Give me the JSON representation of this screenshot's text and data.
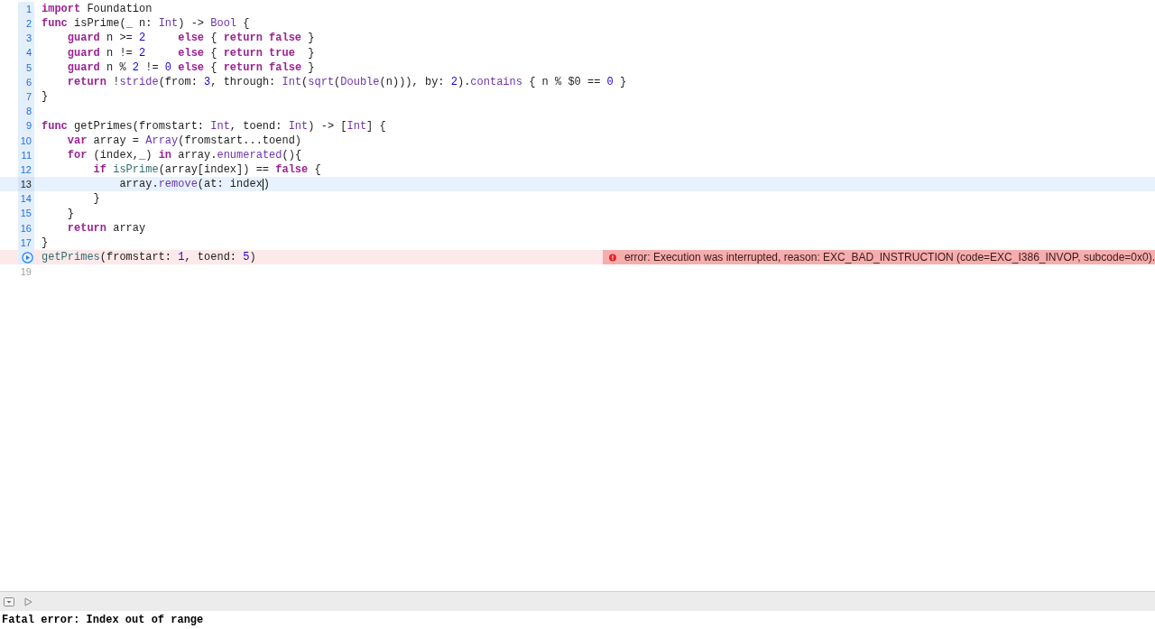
{
  "editor": {
    "lines": [
      {
        "number": "1",
        "executed": true,
        "current": false,
        "tokens": [
          {
            "kind": "kw",
            "text": "import"
          },
          {
            "kind": "plain",
            "text": " Foundation"
          }
        ]
      },
      {
        "number": "2",
        "executed": true,
        "current": false,
        "tokens": [
          {
            "kind": "kw",
            "text": "func"
          },
          {
            "kind": "plain",
            "text": " isPrime("
          },
          {
            "kind": "kw",
            "text": "_"
          },
          {
            "kind": "plain",
            "text": " n: "
          },
          {
            "kind": "type",
            "text": "Int"
          },
          {
            "kind": "plain",
            "text": ") -> "
          },
          {
            "kind": "type",
            "text": "Bool"
          },
          {
            "kind": "plain",
            "text": " {"
          }
        ]
      },
      {
        "number": "3",
        "executed": true,
        "current": false,
        "tokens": [
          {
            "kind": "kw",
            "text": "    guard"
          },
          {
            "kind": "plain",
            "text": " n >= "
          },
          {
            "kind": "num",
            "text": "2"
          },
          {
            "kind": "kw",
            "text": "     else"
          },
          {
            "kind": "plain",
            "text": " { "
          },
          {
            "kind": "kw",
            "text": "return false"
          },
          {
            "kind": "plain",
            "text": " }"
          }
        ]
      },
      {
        "number": "4",
        "executed": true,
        "current": false,
        "tokens": [
          {
            "kind": "kw",
            "text": "    guard"
          },
          {
            "kind": "plain",
            "text": " n != "
          },
          {
            "kind": "num",
            "text": "2"
          },
          {
            "kind": "kw",
            "text": "     else"
          },
          {
            "kind": "plain",
            "text": " { "
          },
          {
            "kind": "kw",
            "text": "return true"
          },
          {
            "kind": "plain",
            "text": "  }"
          }
        ]
      },
      {
        "number": "5",
        "executed": true,
        "current": false,
        "tokens": [
          {
            "kind": "kw",
            "text": "    guard"
          },
          {
            "kind": "plain",
            "text": " n % "
          },
          {
            "kind": "num",
            "text": "2"
          },
          {
            "kind": "plain",
            "text": " != "
          },
          {
            "kind": "num",
            "text": "0"
          },
          {
            "kind": "kw",
            "text": " else"
          },
          {
            "kind": "plain",
            "text": " { "
          },
          {
            "kind": "kw",
            "text": "return false"
          },
          {
            "kind": "plain",
            "text": " }"
          }
        ]
      },
      {
        "number": "6",
        "executed": true,
        "current": false,
        "tokens": [
          {
            "kind": "kw",
            "text": "    return"
          },
          {
            "kind": "plain",
            "text": " !"
          },
          {
            "kind": "fn",
            "text": "stride"
          },
          {
            "kind": "plain",
            "text": "(from: "
          },
          {
            "kind": "num",
            "text": "3"
          },
          {
            "kind": "plain",
            "text": ", through: "
          },
          {
            "kind": "type",
            "text": "Int"
          },
          {
            "kind": "plain",
            "text": "("
          },
          {
            "kind": "fn",
            "text": "sqrt"
          },
          {
            "kind": "plain",
            "text": "("
          },
          {
            "kind": "type",
            "text": "Double"
          },
          {
            "kind": "plain",
            "text": "(n))), by: "
          },
          {
            "kind": "num",
            "text": "2"
          },
          {
            "kind": "plain",
            "text": ")."
          },
          {
            "kind": "fn",
            "text": "contains"
          },
          {
            "kind": "plain",
            "text": " { n % $0 == "
          },
          {
            "kind": "num",
            "text": "0"
          },
          {
            "kind": "plain",
            "text": " }"
          }
        ]
      },
      {
        "number": "7",
        "executed": true,
        "current": false,
        "tokens": [
          {
            "kind": "plain",
            "text": "}"
          }
        ]
      },
      {
        "number": "8",
        "executed": true,
        "current": false
      },
      {
        "number": "9",
        "executed": true,
        "current": false,
        "tokens": [
          {
            "kind": "kw",
            "text": "func"
          },
          {
            "kind": "plain",
            "text": " getPrimes(fromstart: "
          },
          {
            "kind": "type",
            "text": "Int"
          },
          {
            "kind": "plain",
            "text": ", toend: "
          },
          {
            "kind": "type",
            "text": "Int"
          },
          {
            "kind": "plain",
            "text": ") -> ["
          },
          {
            "kind": "type",
            "text": "Int"
          },
          {
            "kind": "plain",
            "text": "] {"
          }
        ]
      },
      {
        "number": "10",
        "executed": true,
        "current": false,
        "tokens": [
          {
            "kind": "kw",
            "text": "    var"
          },
          {
            "kind": "plain",
            "text": " array = "
          },
          {
            "kind": "type",
            "text": "Array"
          },
          {
            "kind": "plain",
            "text": "(fromstart...toend)"
          }
        ]
      },
      {
        "number": "11",
        "executed": true,
        "current": false,
        "tokens": [
          {
            "kind": "kw",
            "text": "    for"
          },
          {
            "kind": "plain",
            "text": " (index,"
          },
          {
            "kind": "kw",
            "text": "_"
          },
          {
            "kind": "plain",
            "text": ") "
          },
          {
            "kind": "kw",
            "text": "in"
          },
          {
            "kind": "plain",
            "text": " array."
          },
          {
            "kind": "fn",
            "text": "enumerated"
          },
          {
            "kind": "plain",
            "text": "(){"
          }
        ]
      },
      {
        "number": "12",
        "executed": true,
        "current": false,
        "tokens": [
          {
            "kind": "kw",
            "text": "        if"
          },
          {
            "kind": "call",
            "text": " isPrime"
          },
          {
            "kind": "plain",
            "text": "(array[index]) == "
          },
          {
            "kind": "kw",
            "text": "false"
          },
          {
            "kind": "plain",
            "text": " {"
          }
        ]
      },
      {
        "number": "13",
        "executed": true,
        "current": true,
        "tokens": [
          {
            "kind": "plain",
            "text": "            array."
          },
          {
            "kind": "fn",
            "text": "remove"
          },
          {
            "kind": "plain",
            "text": "(at: index"
          },
          {
            "kind": "caret"
          },
          {
            "kind": "plain",
            "text": ")"
          }
        ]
      },
      {
        "number": "14",
        "executed": true,
        "current": false,
        "tokens": [
          {
            "kind": "plain",
            "text": "        }"
          }
        ]
      },
      {
        "number": "15",
        "executed": true,
        "current": false,
        "tokens": [
          {
            "kind": "plain",
            "text": "    }"
          }
        ]
      },
      {
        "number": "16",
        "executed": true,
        "current": false,
        "tokens": [
          {
            "kind": "kw",
            "text": "    return"
          },
          {
            "kind": "plain",
            "text": " array"
          }
        ]
      },
      {
        "number": "17",
        "executed": true,
        "current": false,
        "tokens": [
          {
            "kind": "plain",
            "text": "}"
          }
        ]
      },
      {
        "run_button": true,
        "executed": true,
        "current": false,
        "tokens": [
          {
            "kind": "call",
            "text": "getPrimes"
          },
          {
            "kind": "plain",
            "text": "(fromstart: "
          },
          {
            "kind": "num",
            "text": "1"
          },
          {
            "kind": "plain",
            "text": ", toend: "
          },
          {
            "kind": "num",
            "text": "5"
          },
          {
            "kind": "plain",
            "text": ")"
          }
        ],
        "error": "error: Execution was interrupted, reason: EXC_BAD_INSTRUCTION (code=EXC_I386_INVOP, subcode=0x0)."
      },
      {
        "number": "19",
        "executed": false,
        "current": false
      }
    ]
  },
  "console": {
    "output": "Fatal error: Index out of range"
  }
}
